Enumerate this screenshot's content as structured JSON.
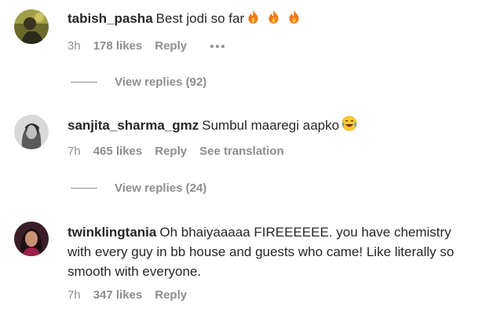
{
  "comments": [
    {
      "username": "tabish_pasha",
      "text": "Best jodi so far",
      "emoji": "fire-icon",
      "time": "3h",
      "likes": "178 likes",
      "reply": "Reply",
      "translation": "",
      "view_replies": "View replies (92)"
    },
    {
      "username": "sanjita_sharma_gmz",
      "text": "Sumbul maaregi aapko",
      "emoji": "laughing-tears-icon",
      "time": "7h",
      "likes": "465 likes",
      "reply": "Reply",
      "translation": "See translation",
      "view_replies": "View replies (24)"
    },
    {
      "username": "twinklingtania",
      "text": "Oh bhaiyaaaaa FIREEEEEE. you have chemistry with every guy in bb house and guests who came! Like literally so smooth with everyone.",
      "emoji": "",
      "time": "7h",
      "likes": "347 likes",
      "reply": "Reply",
      "translation": "",
      "view_replies": ""
    }
  ],
  "colors": {
    "text": "#262626",
    "secondary": "#8e8e8e",
    "fire": "#f07a1a"
  }
}
